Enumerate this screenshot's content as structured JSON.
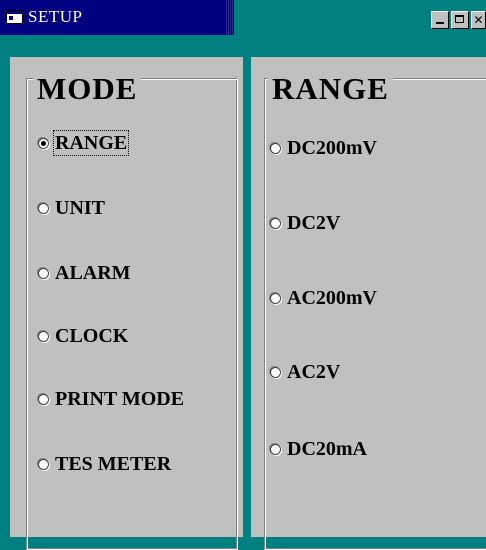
{
  "window": {
    "title": "SETUP"
  },
  "mode_group": {
    "title": "MODE",
    "options": [
      {
        "label": "RANGE",
        "selected": true
      },
      {
        "label": "UNIT",
        "selected": false
      },
      {
        "label": "ALARM",
        "selected": false
      },
      {
        "label": "CLOCK",
        "selected": false
      },
      {
        "label": "PRINT MODE",
        "selected": false
      },
      {
        "label": "TES METER",
        "selected": false
      }
    ]
  },
  "range_group": {
    "title": "RANGE",
    "options": [
      {
        "label": "DC200mV",
        "selected": false
      },
      {
        "label": "DC2V",
        "selected": false
      },
      {
        "label": "AC200mV",
        "selected": false
      },
      {
        "label": "AC2V",
        "selected": false
      },
      {
        "label": "DC20mA",
        "selected": false
      }
    ]
  },
  "colors": {
    "desktop": "#008080",
    "titlebar": "#000080",
    "face": "#c0c0c0"
  }
}
